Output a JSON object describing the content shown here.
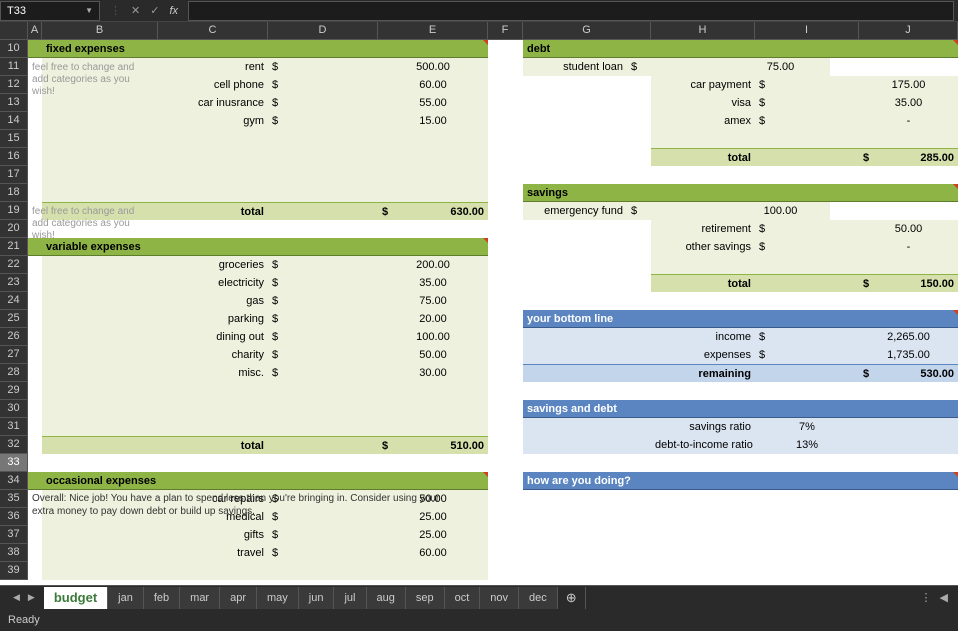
{
  "cellRef": "T33",
  "fx": "fx",
  "status": "Ready",
  "cols": [
    "A",
    "B",
    "C",
    "D",
    "E",
    "F",
    "G",
    "H",
    "I",
    "J"
  ],
  "rows": [
    "10",
    "11",
    "12",
    "13",
    "14",
    "15",
    "16",
    "17",
    "18",
    "19",
    "20",
    "21",
    "22",
    "23",
    "24",
    "25",
    "26",
    "27",
    "28",
    "29",
    "30",
    "31",
    "32",
    "33",
    "34",
    "35",
    "36",
    "37",
    "38",
    "39"
  ],
  "tabs": {
    "active": "budget",
    "all": [
      "budget",
      "jan",
      "feb",
      "mar",
      "apr",
      "may",
      "jun",
      "jul",
      "aug",
      "sep",
      "oct",
      "nov",
      "dec"
    ],
    "add": "⊕"
  },
  "left": {
    "fixed": {
      "header": "fixed expenses",
      "items": [
        {
          "label": "rent",
          "cur": "$",
          "val": "500.00"
        },
        {
          "label": "cell phone",
          "cur": "$",
          "val": "60.00"
        },
        {
          "label": "car inusrance",
          "cur": "$",
          "val": "55.00"
        },
        {
          "label": "gym",
          "cur": "$",
          "val": "15.00"
        }
      ],
      "totalLabel": "total",
      "totalCur": "$",
      "totalVal": "630.00"
    },
    "variable": {
      "header": "variable expenses",
      "items": [
        {
          "label": "groceries",
          "cur": "$",
          "val": "200.00"
        },
        {
          "label": "electricity",
          "cur": "$",
          "val": "35.00"
        },
        {
          "label": "gas",
          "cur": "$",
          "val": "75.00"
        },
        {
          "label": "parking",
          "cur": "$",
          "val": "20.00"
        },
        {
          "label": "dining out",
          "cur": "$",
          "val": "100.00"
        },
        {
          "label": "charity",
          "cur": "$",
          "val": "50.00"
        },
        {
          "label": "misc.",
          "cur": "$",
          "val": "30.00"
        }
      ],
      "totalLabel": "total",
      "totalCur": "$",
      "totalVal": "510.00"
    },
    "occasional": {
      "header": "occasional expenses",
      "items": [
        {
          "label": "car repairs",
          "cur": "$",
          "val": "50.00"
        },
        {
          "label": "medical",
          "cur": "$",
          "val": "25.00"
        },
        {
          "label": "gifts",
          "cur": "$",
          "val": "25.00"
        },
        {
          "label": "travel",
          "cur": "$",
          "val": "60.00"
        }
      ]
    }
  },
  "right": {
    "note": "feel free to change and add categories as you wish!",
    "debt": {
      "header": "debt",
      "items": [
        {
          "label": "student loan",
          "cur": "$",
          "val": "75.00"
        },
        {
          "label": "car payment",
          "cur": "$",
          "val": "175.00"
        },
        {
          "label": "visa",
          "cur": "$",
          "val": "35.00"
        },
        {
          "label": "amex",
          "cur": "$",
          "val": "-"
        }
      ],
      "totalLabel": "total",
      "totalCur": "$",
      "totalVal": "285.00"
    },
    "savings": {
      "header": "savings",
      "items": [
        {
          "label": "emergency fund",
          "cur": "$",
          "val": "100.00"
        },
        {
          "label": "retirement",
          "cur": "$",
          "val": "50.00"
        },
        {
          "label": "other savings",
          "cur": "$",
          "val": "-"
        }
      ],
      "totalLabel": "total",
      "totalCur": "$",
      "totalVal": "150.00"
    },
    "bottom": {
      "header": "your bottom line",
      "income": {
        "label": "income",
        "cur": "$",
        "val": "2,265.00"
      },
      "expenses": {
        "label": "expenses",
        "cur": "$",
        "val": "1,735.00"
      },
      "remaining": {
        "label": "remaining",
        "cur": "$",
        "val": "530.00"
      }
    },
    "ratios": {
      "header": "savings and debt",
      "sav": {
        "label": "savings ratio",
        "val": "7%"
      },
      "dti": {
        "label": "debt-to-income ratio",
        "val": "13%"
      }
    },
    "how": {
      "header": "how are you doing?",
      "text": "Overall: Nice job! You have a plan to spend less than you're bringing in. Consider using your extra money to pay down debt or build up savings."
    }
  }
}
